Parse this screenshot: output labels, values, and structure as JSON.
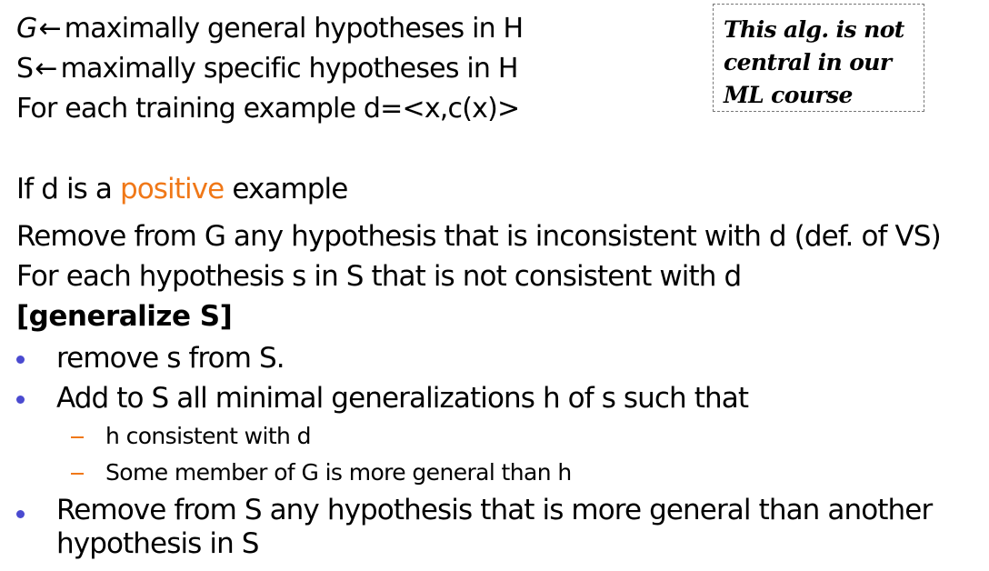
{
  "note_box": {
    "text": "This alg. is  not\ncentral in our\nML course"
  },
  "header": {
    "line1": {
      "symbol": "G",
      "arrow": "←",
      "text": "maximally general hypotheses in H"
    },
    "line2": {
      "symbol": "S",
      "arrow": "←",
      "text": "maximally specific hypotheses in H"
    },
    "line3": {
      "text": "For each training example d=<x,c(x)>"
    }
  },
  "body": {
    "if_line": {
      "prefix": "If d is a",
      "highlight": "positive",
      "suffix": "example"
    },
    "remove_g": "Remove from G any hypothesis that is inconsistent with d (def. of VS)",
    "for_each_s": "For each hypothesis s in S that is not consistent with d",
    "generalize_label": "[generalize S]",
    "bullets": [
      {
        "text": "remove s from S."
      },
      {
        "text": "Add to S all minimal generalizations h of s such that",
        "sub_items": [
          "h consistent with d",
          "Some member of G is more general than h"
        ]
      },
      {
        "line1": "Remove from S any hypothesis that is more general than another",
        "line2": "hypothesis in S"
      }
    ]
  },
  "colors": {
    "accent": "#f07818",
    "bullet": "#4a4ad0",
    "text": "#000000",
    "box_border": "#777777"
  }
}
